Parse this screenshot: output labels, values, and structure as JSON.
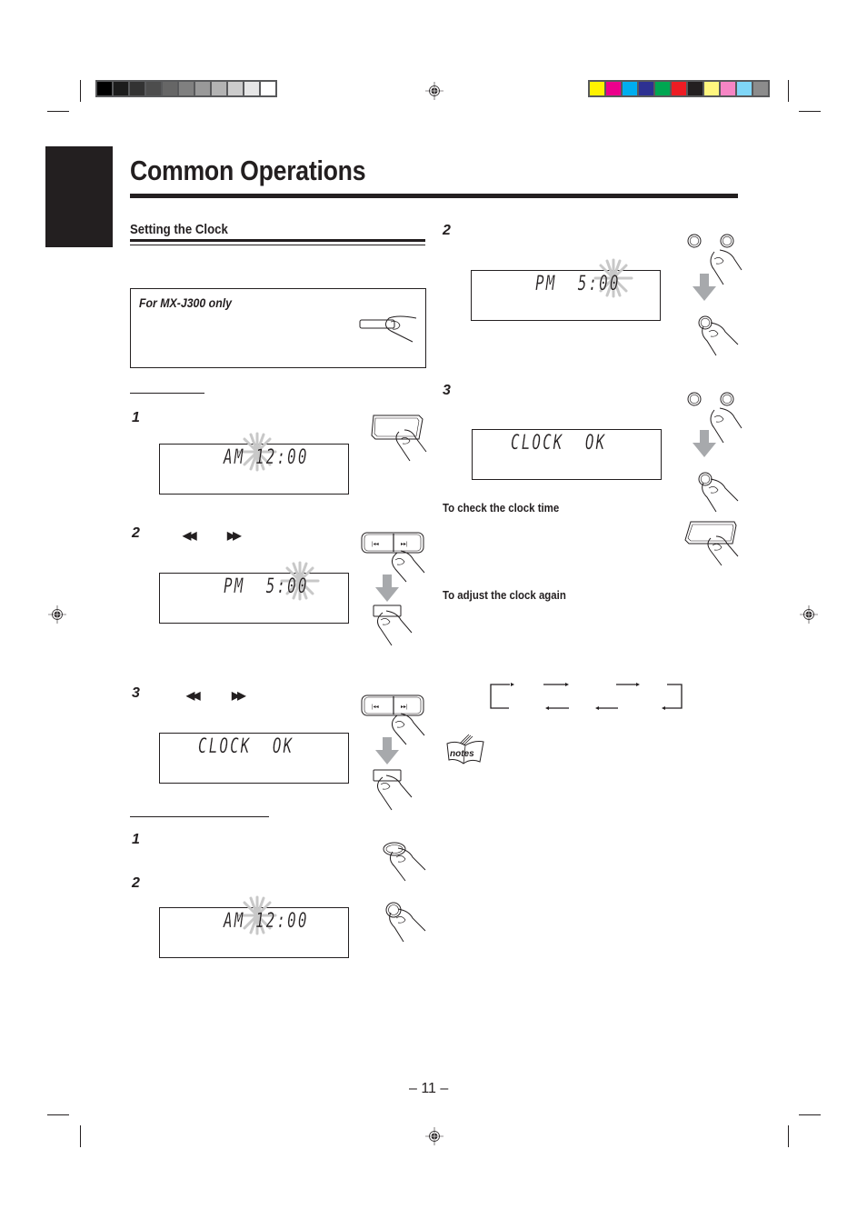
{
  "page": {
    "title": "Common Operations",
    "page_number": "– 11 –"
  },
  "print_marks": {
    "gray_bar": [
      "#000000",
      "#1c1c1c",
      "#333333",
      "#4d4d4d",
      "#666666",
      "#808080",
      "#999999",
      "#b3b3b3",
      "#cccccc",
      "#e6e6e6",
      "#ffffff"
    ],
    "color_bar": [
      "#fff200",
      "#ec008c",
      "#00aeef",
      "#2e3192",
      "#00a651",
      "#ed1c24",
      "#231f20",
      "#fff67f",
      "#f685c4",
      "#7fd6f7",
      "#8c8c8c"
    ]
  },
  "left_column": {
    "section_title": "Setting the Clock",
    "note_box": {
      "title": "For MX-J300 only"
    },
    "procedure_a": {
      "steps": [
        {
          "number": "1",
          "display": "AM 12:00"
        },
        {
          "number": "2",
          "skip_back": "◀◀",
          "skip_fwd": "▶▶",
          "display": "PM  5:00"
        },
        {
          "number": "3",
          "skip_back": "◀◀",
          "skip_fwd": "▶▶",
          "display": "CLOCK  OK"
        }
      ]
    },
    "procedure_b": {
      "steps": [
        {
          "number": "1"
        },
        {
          "number": "2",
          "display": "AM 12:00"
        }
      ]
    }
  },
  "right_column": {
    "steps": [
      {
        "number": "2",
        "display": "PM  5:00"
      },
      {
        "number": "3",
        "display": "CLOCK  OK"
      }
    ],
    "check_heading": "To check the clock time",
    "adjust_heading": "To adjust the clock again",
    "notes_icon_label": "notes"
  }
}
